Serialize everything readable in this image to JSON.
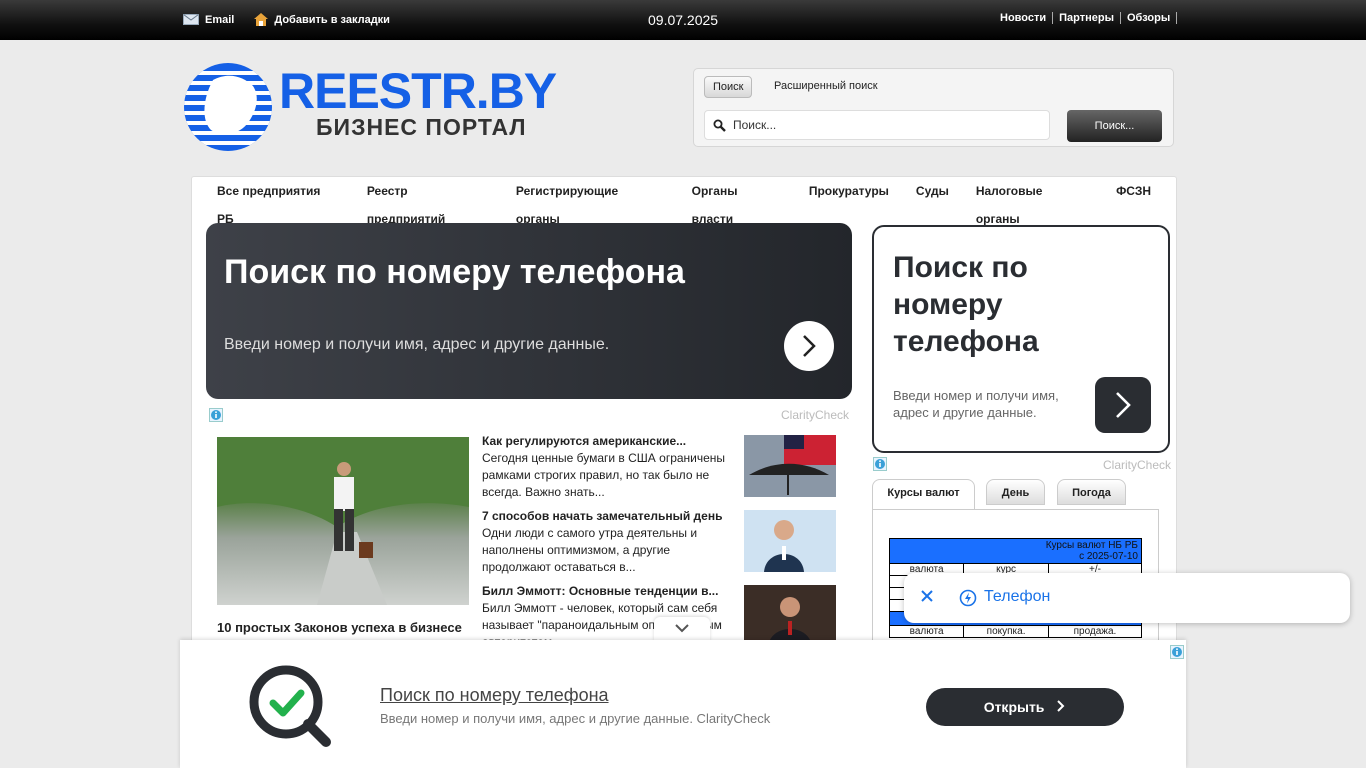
{
  "topbar": {
    "email_label": "Email",
    "bookmark_label": "Добавить в закладки",
    "date": "09.07.2025",
    "links": [
      "Новости",
      "Партнеры",
      "Обзоры"
    ]
  },
  "logo": {
    "word": "REESTR.BY",
    "sub": "БИЗНЕС ПОРТАЛ"
  },
  "search": {
    "tab_simple": "Поиск",
    "tab_advanced": "Расширенный поиск",
    "placeholder": "Поиск...",
    "button": "Поиск..."
  },
  "nav": [
    "Все предприятия РБ",
    "Реестр предприятий",
    "Регистрирующие органы",
    "Органы власти",
    "Прокуратуры",
    "Суды",
    "Налоговые органы",
    "ФСЗН"
  ],
  "ad_main": {
    "title": "Поиск по номеру телефона",
    "text": "Введи номер и получи имя, адрес и другие данные.",
    "brand": "ClarityCheck"
  },
  "feature": {
    "title": "10 простых Законов успеха в бизнесе"
  },
  "news": [
    {
      "title": "Как регулируются американские...",
      "text": "Сегодня ценные бумаги в США ограничены рамками строгих правил, но так было не всегда. Важно знать..."
    },
    {
      "title": "7 способов начать замечательный день",
      "text": "Одни люди с самого утра деятельны и наполнены оптимизмом, а другие продолжают оставаться в..."
    },
    {
      "title": "Билл Эммотт: Основные тенденции в...",
      "text": "Билл Эммотт - человек, который сам себя называет \"параноидальным оп            \", с особым авторитетом..."
    }
  ],
  "ad_side": {
    "title": "Поиск по номеру телефона",
    "text": "Введи номер и получи имя, адрес и другие данные.",
    "brand": "ClarityCheck"
  },
  "tabs": [
    "Курсы валют",
    "День",
    "Погода"
  ],
  "currency": {
    "header1": "Курсы валют НБ РБ",
    "header2": "с   2025-07-10",
    "cols": [
      "валюта",
      "курс",
      "+/-"
    ],
    "header3": "2025-07-09",
    "cols2": [
      "валюта",
      "покупка.",
      "продажа."
    ]
  },
  "popup": {
    "label": "Телефон"
  },
  "bottom_ad": {
    "title": "Поиск по номеру телефона",
    "text": "Введи номер и получи имя, адрес и другие данные. ClarityCheck",
    "button": "Открыть"
  }
}
